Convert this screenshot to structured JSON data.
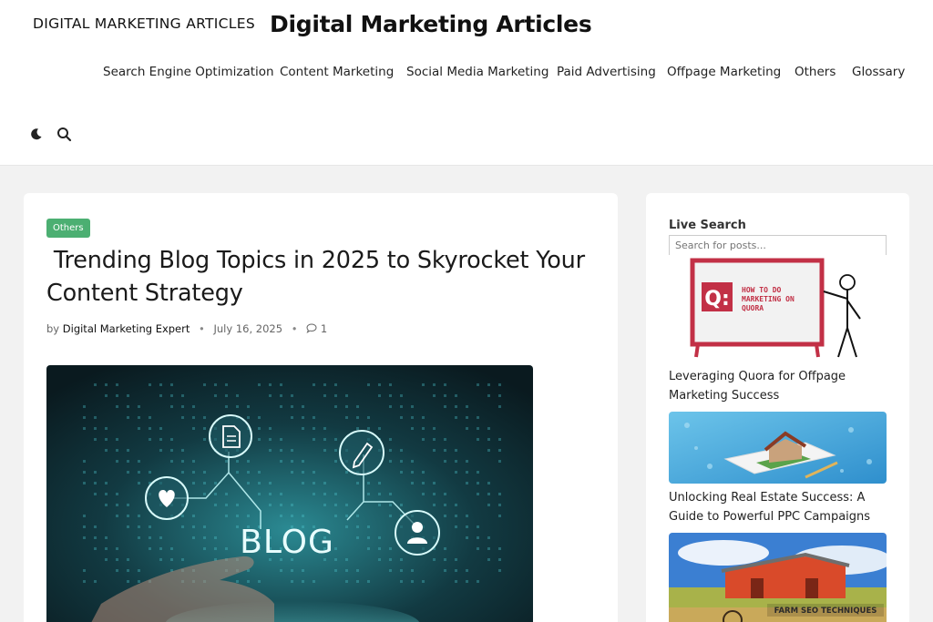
{
  "header": {
    "site_name_small": "DIGITAL MARKETING ARTICLES",
    "site_name_large": "Digital Marketing Articles",
    "nav": [
      {
        "label": "Search Engine Optimization"
      },
      {
        "label": "Content Marketing"
      },
      {
        "label": "Social Media Marketing"
      },
      {
        "label": "Paid Advertising"
      },
      {
        "label": "Offpage Marketing"
      },
      {
        "label": "Others"
      },
      {
        "label": "Glossary"
      }
    ],
    "icons": {
      "theme_toggle": "moon-icon",
      "search": "search-icon"
    }
  },
  "post": {
    "category": "Others",
    "title": " Trending Blog Topics in 2025 to Skyrocket Your Content Strategy",
    "by_label": "by",
    "author": "Digital Marketing Expert",
    "date": "July 16, 2025",
    "comments": "1",
    "hero_text": "BLOG"
  },
  "sidebar": {
    "live_search_title": "Live Search",
    "search_placeholder": "Search for posts...",
    "posts": [
      {
        "title": "Leveraging Quora for Offpage Marketing Success",
        "thumb_text": "HOW TO DO MARKETING ON QUORA",
        "thumb_letter": "Q:"
      },
      {
        "title": "Unlocking Real Estate Success: A Guide to Powerful PPC Campaigns"
      },
      {
        "title": "",
        "thumb_text": "FARM SEO TECHNIQUES"
      }
    ]
  },
  "colors": {
    "badge": "#4caf72",
    "hero_glow": "#3ee0e6",
    "quora_red": "#c23046"
  }
}
